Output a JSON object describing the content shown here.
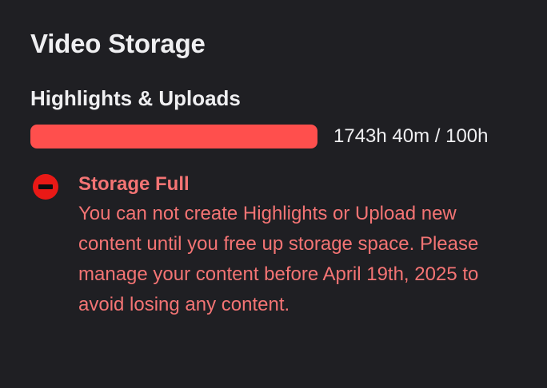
{
  "header": {
    "title": "Video Storage"
  },
  "usage": {
    "label": "Highlights & Uploads",
    "amount_text": "1743h 40m / 100h",
    "fill_fraction": 1.0
  },
  "alert": {
    "icon": "minus-circle-icon",
    "title": "Storage Full",
    "message": "You can not create Highlights or Upload new content until you free up storage space. Please manage your content before April 19th, 2025 to avoid losing any content."
  },
  "colors": {
    "background": "#1f1f23",
    "bar_fill": "#ff4f4d",
    "alert_text": "#f47474",
    "alert_icon": "#e91916"
  }
}
